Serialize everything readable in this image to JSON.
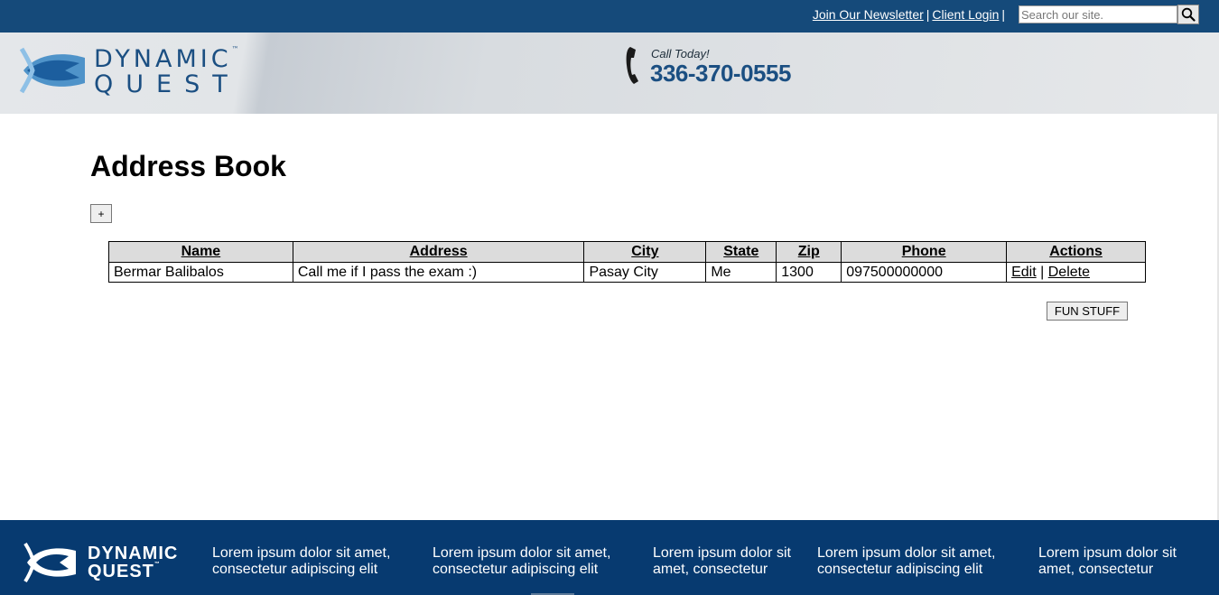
{
  "topbar": {
    "links": [
      {
        "label": "Join Our Newsletter"
      },
      {
        "label": "Client Login"
      }
    ],
    "separator": "|",
    "search": {
      "placeholder": "Search our site.",
      "value": ""
    }
  },
  "header": {
    "logo": {
      "line1": "DYNAMIC",
      "line2": "QUEST",
      "tm": "™"
    },
    "call_today": "Call Today!",
    "phone": "336-370-0555"
  },
  "main": {
    "title": "Address Book",
    "add_button": "+",
    "table": {
      "columns": [
        "Name",
        "Address",
        "City",
        "State",
        "Zip",
        "Phone",
        "Actions"
      ],
      "rows": [
        {
          "name": "Bermar Balibalos",
          "address": "Call me if I pass the exam :)",
          "city": "Pasay City",
          "state": "Me",
          "zip": "1300",
          "phone": "097500000000",
          "edit": "Edit",
          "delete": "Delete"
        }
      ]
    },
    "fun_button": "FUN STUFF"
  },
  "footer": {
    "logo": {
      "line1": "DYNAMIC",
      "line2": "QUEST",
      "tm": "™"
    },
    "columns": [
      {
        "line1": "Lorem ipsum dolor sit amet,",
        "line2": "consectetur adipiscing elit"
      },
      {
        "line1": "Lorem ipsum dolor sit amet,",
        "line2": "consectetur adipiscing elit"
      },
      {
        "line1": "Lorem ipsum dolor sit",
        "line2": "amet, consectetur"
      },
      {
        "line1": "Lorem ipsum dolor sit amet,",
        "line2": "consectetur adipiscing elit"
      },
      {
        "line1": "Lorem ipsum dolor sit",
        "line2": "amet, consectetur"
      }
    ]
  },
  "colors": {
    "topbar": "#154a7a",
    "footer": "#073a70",
    "brand": "#1b4f82"
  }
}
